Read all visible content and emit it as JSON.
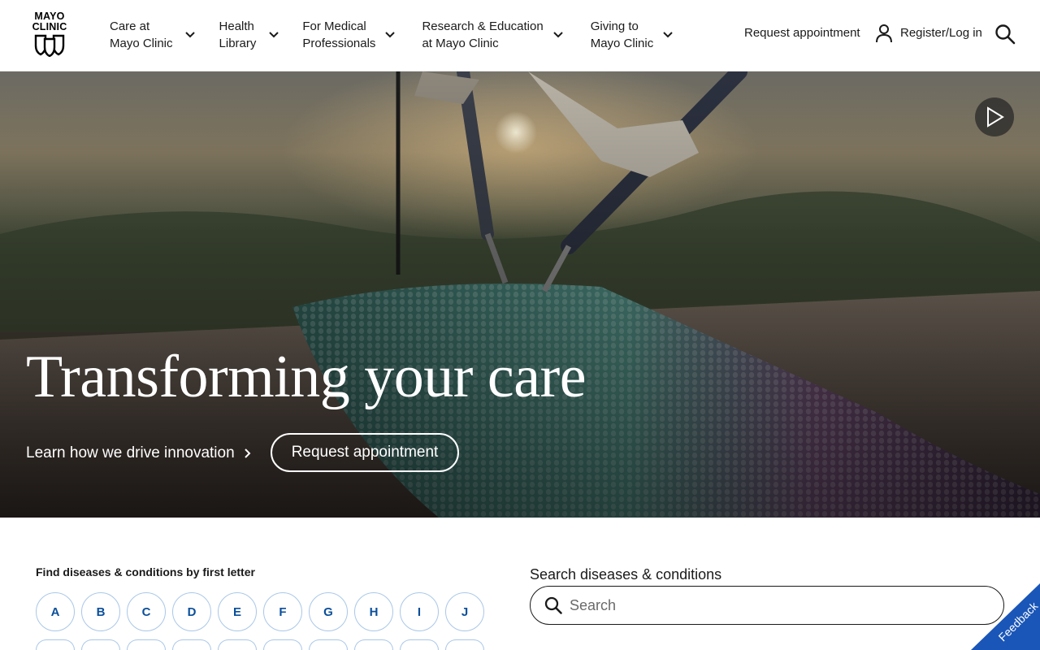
{
  "logo": {
    "line1": "MAYO",
    "line2": "CLINIC"
  },
  "nav": {
    "items": [
      {
        "line1": "Care at",
        "line2": "Mayo Clinic"
      },
      {
        "line1": "Health",
        "line2": "Library"
      },
      {
        "line1": "For Medical",
        "line2": "Professionals"
      },
      {
        "line1": "Research & Education",
        "line2": "at Mayo Clinic"
      },
      {
        "line1": "Giving to",
        "line2": "Mayo Clinic"
      }
    ],
    "request_appointment": "Request appointment",
    "register_login": "Register/Log in"
  },
  "hero": {
    "title": "Transforming your care",
    "link_label": "Learn how we drive innovation",
    "button_label": "Request appointment"
  },
  "find": {
    "title": "Find diseases & conditions by first letter",
    "letters": [
      "A",
      "B",
      "C",
      "D",
      "E",
      "F",
      "G",
      "H",
      "I",
      "J"
    ]
  },
  "search": {
    "title": "Search diseases & conditions",
    "placeholder": "Search"
  },
  "feedback": {
    "label": "Feedback"
  },
  "colors": {
    "accent_blue": "#0a4f9a",
    "feedback_blue": "#1a56b8",
    "letter_border": "#a9c7e8"
  }
}
